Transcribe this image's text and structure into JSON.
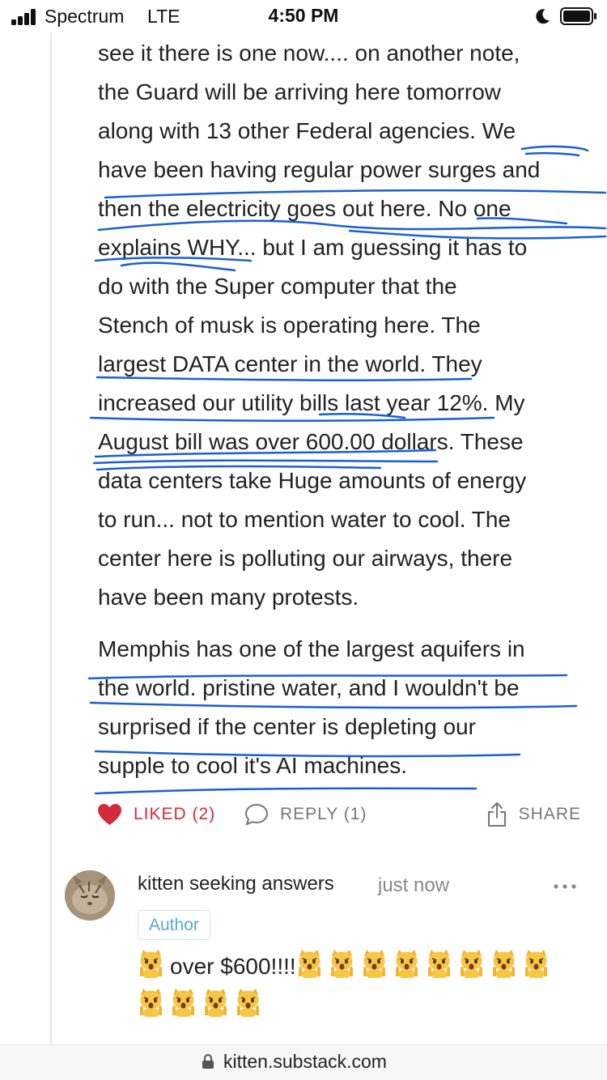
{
  "status_bar": {
    "carrier": "Spectrum",
    "network": "LTE",
    "time": "4:50 PM",
    "signal_bars": 4,
    "icons": [
      "signal-icon",
      "moon-icon",
      "battery-icon"
    ]
  },
  "comment": {
    "paragraph1_lines": [
      "see it there is one now.... on another note,",
      "the Guard will be arriving here tomorrow",
      "along with 13 other Federal agencies. We",
      "have been having regular power surges and",
      "then the electricity goes out here. No one",
      "explains WHY... but I am guessing it has to",
      "do with the Super computer that the",
      "Stench of musk is operating here. The",
      "largest DATA center in the world. They",
      "increased our utility bills last year 12%. My",
      "August bill was over 600.00 dollars. These",
      "data centers take Huge amounts of energy",
      "to run... not to mention water to cool. The",
      "center here is polluting our airways, there",
      "have been many protests."
    ],
    "paragraph2_lines": [
      "Memphis has one of the largest aquifers in",
      "the world. pristine water, and I wouldn't be",
      "surprised if the center is depleting our",
      "supple to cool it's AI machines."
    ],
    "actions": {
      "liked_label": "LIKED (2)",
      "reply_label": "REPLY (1)",
      "share_label": "SHARE"
    }
  },
  "reply": {
    "author": "kitten seeking answers",
    "timestamp": "just now",
    "badge": "Author",
    "text": "over $600!!!!",
    "emoji_name": "weary-cat-face",
    "emoji_count_line1": 8,
    "emoji_count_line2": 4
  },
  "browser": {
    "url": "kitten.substack.com"
  },
  "colors": {
    "liked_red": "#d32b3c",
    "annotation_blue": "#1a5fd6",
    "author_badge_blue": "#5aa6dc"
  }
}
